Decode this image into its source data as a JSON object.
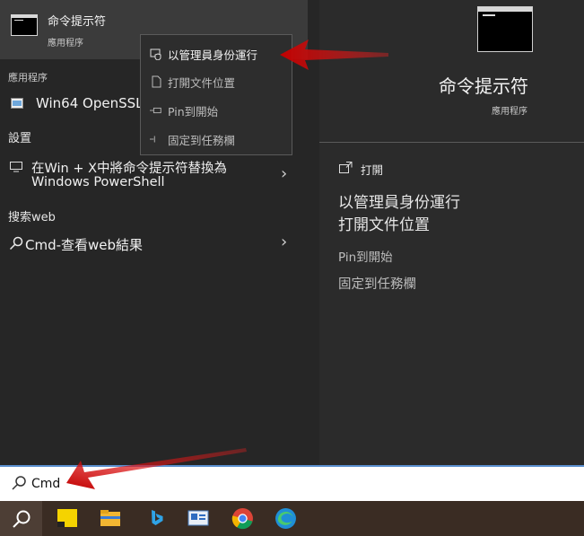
{
  "top_result": {
    "title": "命令提示符",
    "subtitle": "應用程序"
  },
  "sections": {
    "apps_header": "應用程序",
    "settings_header": "設置",
    "web_header": "搜索web"
  },
  "apps": [
    {
      "label": "Win64 OpenSSL C"
    }
  ],
  "settings_item": {
    "line1": "在Win + X中將命令提示符替換為",
    "line2": "Windows PowerShell"
  },
  "web_item": {
    "label": "Cmd-查看web結果"
  },
  "context_menu": {
    "items": [
      {
        "label": "以管理員身份運行",
        "icon": "shield-icon"
      },
      {
        "label": "打開文件位置",
        "icon": "file-icon"
      },
      {
        "label": "Pin到開始",
        "icon": "pin-icon"
      },
      {
        "label": "固定到任務欄",
        "icon": "pin-taskbar-icon"
      }
    ]
  },
  "preview": {
    "title": "命令提示符",
    "subtitle": "應用程序",
    "actions": {
      "open": "打開",
      "run_as_admin": "以管理員身份運行",
      "open_location": "打開文件位置",
      "pin_start": "Pin到開始",
      "pin_taskbar": "固定到任務欄"
    }
  },
  "search": {
    "value": "Cmd"
  },
  "colors": {
    "accent": "#4a90d9",
    "arrow": "#e01010",
    "panel": "#262626"
  }
}
